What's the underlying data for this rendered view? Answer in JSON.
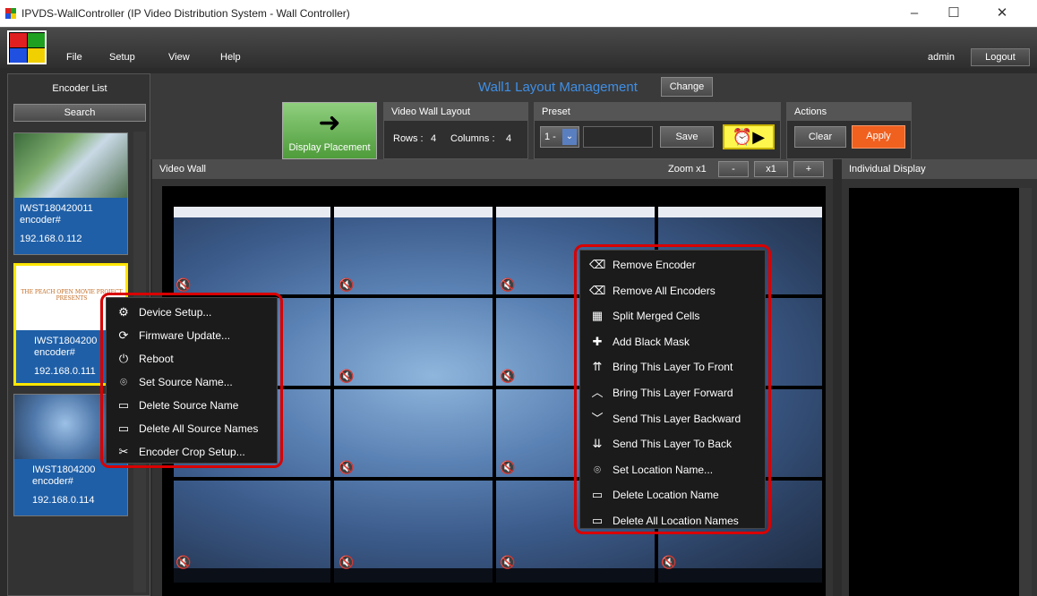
{
  "window": {
    "title": "IPVDS-WallController (IP Video Distribution System - Wall Controller)",
    "min_icon": "minimize-icon",
    "max_icon": "maximize-icon",
    "close_icon": "close-icon"
  },
  "menu": {
    "file": "File",
    "setup": "Setup",
    "view": "View",
    "help": "Help",
    "user": "admin",
    "logout": "Logout"
  },
  "encoder_list": {
    "title": "Encoder List",
    "search": "Search",
    "items": [
      {
        "name": "IWST180420011",
        "sub": "encoder#",
        "ip": "192.168.0.112"
      },
      {
        "name": "IWST1804200",
        "sub": "encoder#",
        "ip": "192.168.0.111",
        "thumb_text": "THE PEACH OPEN MOVIE PROJECT PRESENTS"
      },
      {
        "name": "IWST1804200",
        "sub": "encoder#",
        "ip": "192.168.0.114"
      }
    ]
  },
  "layout": {
    "title": "Wall1 Layout Management",
    "change": "Change",
    "display_placement": "Display Placement",
    "video_wall_layout": "Video Wall Layout",
    "rows_label": "Rows :",
    "rows": "4",
    "columns_label": "Columns :",
    "columns": "4",
    "preset": "Preset",
    "preset_value": "1 -",
    "save": "Save",
    "actions": "Actions",
    "clear": "Clear",
    "apply": "Apply"
  },
  "video_wall": {
    "title": "Video Wall",
    "zoom_label": "Zoom x1",
    "zoom_minus": "-",
    "zoom_x1": "x1",
    "zoom_plus": "+"
  },
  "individual_display": {
    "title": "Individual Display"
  },
  "encoder_context_menu": [
    {
      "icon": "gear-link-icon",
      "label": "Device Setup..."
    },
    {
      "icon": "firmware-icon",
      "label": "Firmware Update..."
    },
    {
      "icon": "power-icon",
      "label": "Reboot"
    },
    {
      "icon": "location-pin-icon",
      "label": "Set Source Name..."
    },
    {
      "icon": "minus-box-icon",
      "label": "Delete Source Name"
    },
    {
      "icon": "minus-box-icon",
      "label": "Delete All Source Names"
    },
    {
      "icon": "scissors-icon",
      "label": "Encoder Crop Setup..."
    }
  ],
  "wall_context_menu": [
    {
      "icon": "eraser-icon",
      "label": "Remove Encoder"
    },
    {
      "icon": "eraser-icon",
      "label": "Remove All Encoders"
    },
    {
      "icon": "grid-icon",
      "label": "Split Merged Cells"
    },
    {
      "icon": "plus-outline-icon",
      "label": "Add Black Mask"
    },
    {
      "icon": "bring-front-icon",
      "label": "Bring This Layer To Front"
    },
    {
      "icon": "chevron-up-icon",
      "label": "Bring This Layer Forward"
    },
    {
      "icon": "chevron-down-icon",
      "label": "Send This Layer Backward"
    },
    {
      "icon": "send-back-icon",
      "label": "Send This Layer To Back"
    },
    {
      "icon": "location-pin-icon",
      "label": "Set Location Name..."
    },
    {
      "icon": "minus-box-icon",
      "label": "Delete Location Name"
    },
    {
      "icon": "minus-box-icon",
      "label": "Delete All Location Names"
    }
  ],
  "colors": {
    "accent_blue": "#3f8fe6",
    "apply_orange": "#f0601f",
    "highlight_red": "#d90000",
    "selected_yellow": "#ffe600"
  }
}
